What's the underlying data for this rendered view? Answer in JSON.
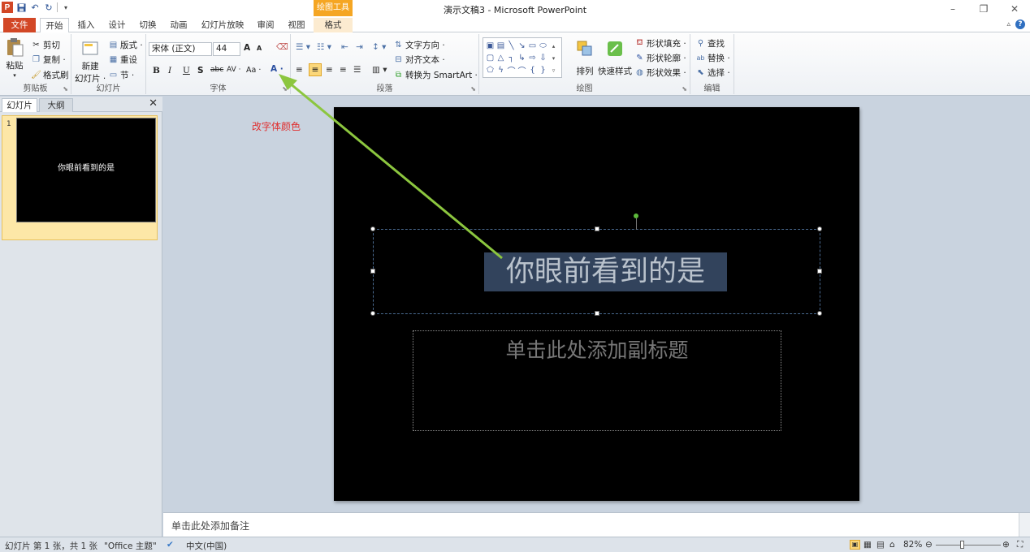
{
  "window": {
    "app_title": "演示文稿3 - Microsoft PowerPoint",
    "contextual_tab_group": "绘图工具",
    "icons": [
      "powerpoint-logo-icon",
      "save-icon",
      "undo-icon",
      "redo-icon",
      "customize-qat-icon",
      "minimize-icon",
      "restore-icon",
      "close-icon"
    ]
  },
  "tabs": [
    "文件",
    "开始",
    "插入",
    "设计",
    "切换",
    "动画",
    "幻灯片放映",
    "审阅",
    "视图",
    "格式"
  ],
  "active_tab": "开始",
  "ribbon": {
    "clipboard": {
      "paste": "粘贴",
      "cut": "剪切",
      "copy": "复制 ·",
      "format_painter": "格式刷",
      "label": "剪贴板"
    },
    "slides": {
      "new_slide": "新建",
      "new_slide_2": "幻灯片 ·",
      "layout": "版式 ·",
      "reset": "重设",
      "section": "节 ·",
      "label": "幻灯片"
    },
    "font": {
      "font_name": "宋体 (正文)",
      "font_size": "44",
      "grow": "A",
      "shrink": "A",
      "bold": "B",
      "italic": "I",
      "underline": "U",
      "shadow": "S",
      "strike": "abc",
      "spacing": "AV ·",
      "case": "Aa ·",
      "color": "A ·",
      "label": "字体"
    },
    "paragraph": {
      "text_direction": "文字方向 ·",
      "align_text": "对齐文本 ·",
      "smartart": "转换为 SmartArt ·",
      "label": "段落"
    },
    "drawing": {
      "arrange": "排列",
      "quick_styles": "快速样式",
      "shape_fill": "形状填充 ·",
      "shape_outline": "形状轮廓 ·",
      "shape_effects": "形状效果 ·",
      "label": "绘图"
    },
    "editing": {
      "find": "查找",
      "replace": "替换 ·",
      "select": "选择 ·",
      "label": "编辑"
    }
  },
  "slide_pane": {
    "tabs": [
      "幻灯片",
      "大纲"
    ],
    "thumbnails": [
      {
        "number": "1",
        "text": "你眼前看到的是"
      }
    ]
  },
  "slide": {
    "title": "你眼前看到的是",
    "subtitle_placeholder": "单击此处添加副标题",
    "background": "#000000",
    "title_highlight": "#32435c"
  },
  "annotation": {
    "text": "改字体颜色",
    "color": "#e03030",
    "arrow_color": "#8cc63f"
  },
  "notes_placeholder": "单击此处添加备注",
  "status": {
    "slide_info": "幻灯片 第 1 张，共 1 张",
    "theme": "\"Office 主题\"",
    "language": "中文(中国)",
    "zoom": "82%"
  },
  "colors": {
    "file_tab": "#d24726",
    "contextual": "#f5a623",
    "accent": "#2f6fc0"
  }
}
